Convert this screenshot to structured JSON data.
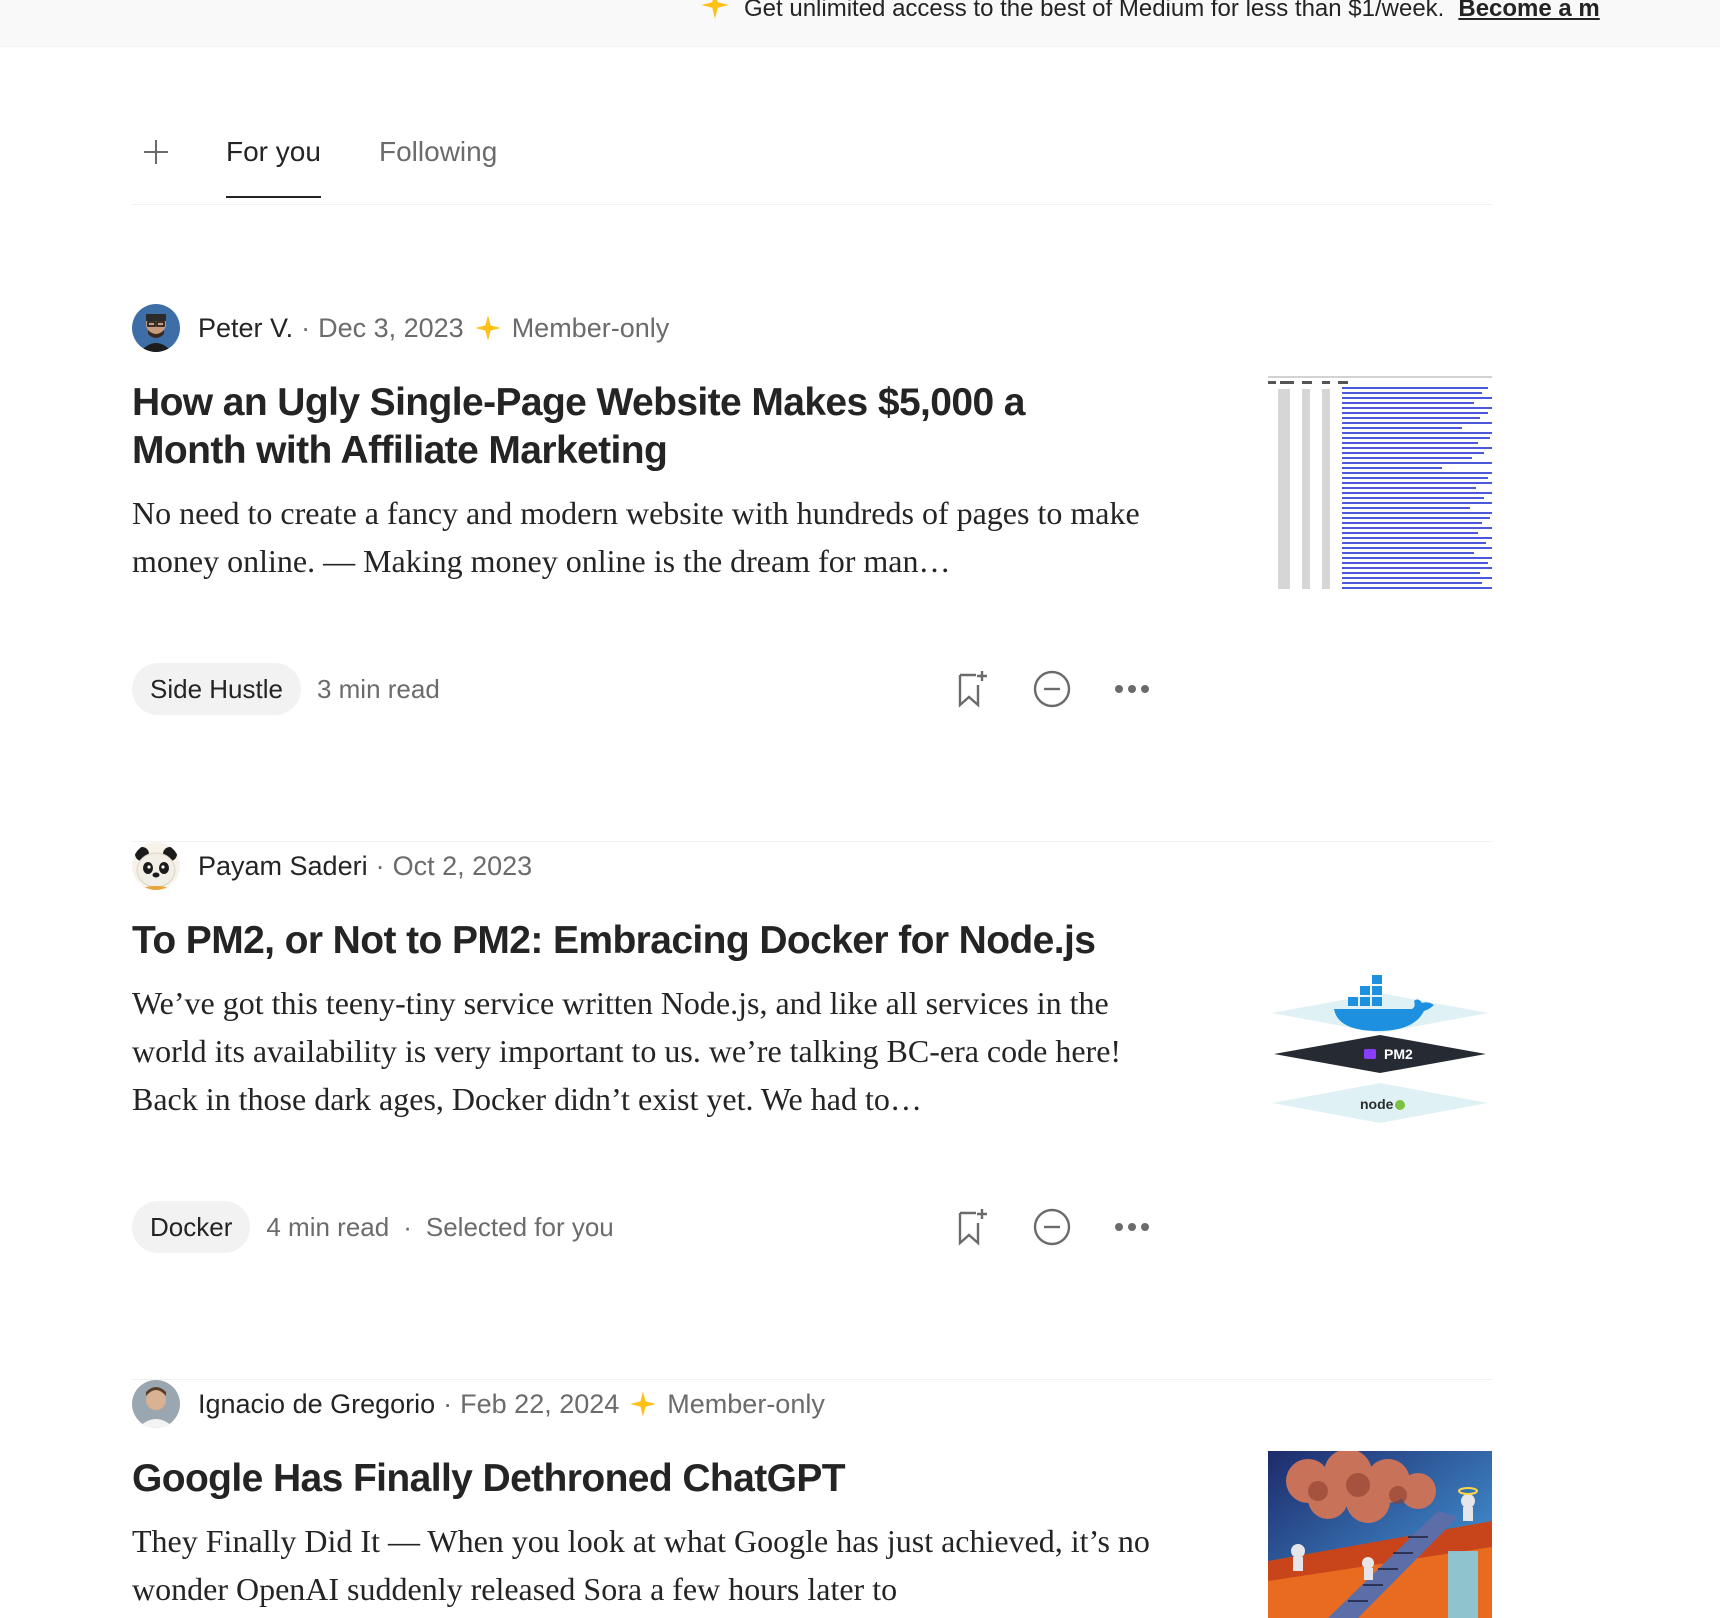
{
  "banner": {
    "text": "Get unlimited access to the best of Medium for less than $1/week.",
    "link": "Become a m"
  },
  "tabs": [
    {
      "label": "For you",
      "active": true
    },
    {
      "label": "Following",
      "active": false
    }
  ],
  "articles": [
    {
      "author": "Peter V.",
      "date": "Dec 3, 2023",
      "member_only": "Member-only",
      "title": "How an Ugly Single-Page Website Makes $5,000 a Month with Affiliate Marketing",
      "subtitle": "No need to create a fancy and modern website with hundreds of pages to make money online. — Making money online is the dream for man…",
      "tag": "Side Hustle",
      "read_time": "3 min read",
      "thumb": "spreadsheet"
    },
    {
      "author": "Payam Saderi",
      "date": "Oct 2, 2023",
      "title": "To PM2, or Not to PM2: Embracing Docker for Node.js",
      "subtitle": "We’ve got this teeny-tiny service written Node.js, and like all services in the world its availability is very important to us. we’re talking BC-era code here! Back in those dark ages, Docker didn’t exist yet. We had to…",
      "tag": "Docker",
      "read_time": "4 min read",
      "extra": "Selected for you",
      "thumb": "docker-pm2-node",
      "thumb_labels": {
        "pm2": "PM2",
        "node": "node"
      }
    },
    {
      "author": "Ignacio de Gregorio",
      "date": "Feb 22, 2024",
      "member_only": "Member-only",
      "title": "Google Has Finally Dethroned ChatGPT",
      "subtitle": "They Finally Did It — When you look at what Google has just achieved, it’s no wonder OpenAI suddenly released Sora a few hours later to",
      "thumb": "robots-illustration"
    }
  ],
  "icons": {
    "plus": "plus-icon",
    "star": "sparkle-star-icon",
    "save": "bookmark-add-icon",
    "hide": "minus-circle-icon",
    "more": "more-dots-icon"
  },
  "colors": {
    "star": "#FFC017",
    "text": "#242424",
    "muted": "#6B6B6B"
  }
}
